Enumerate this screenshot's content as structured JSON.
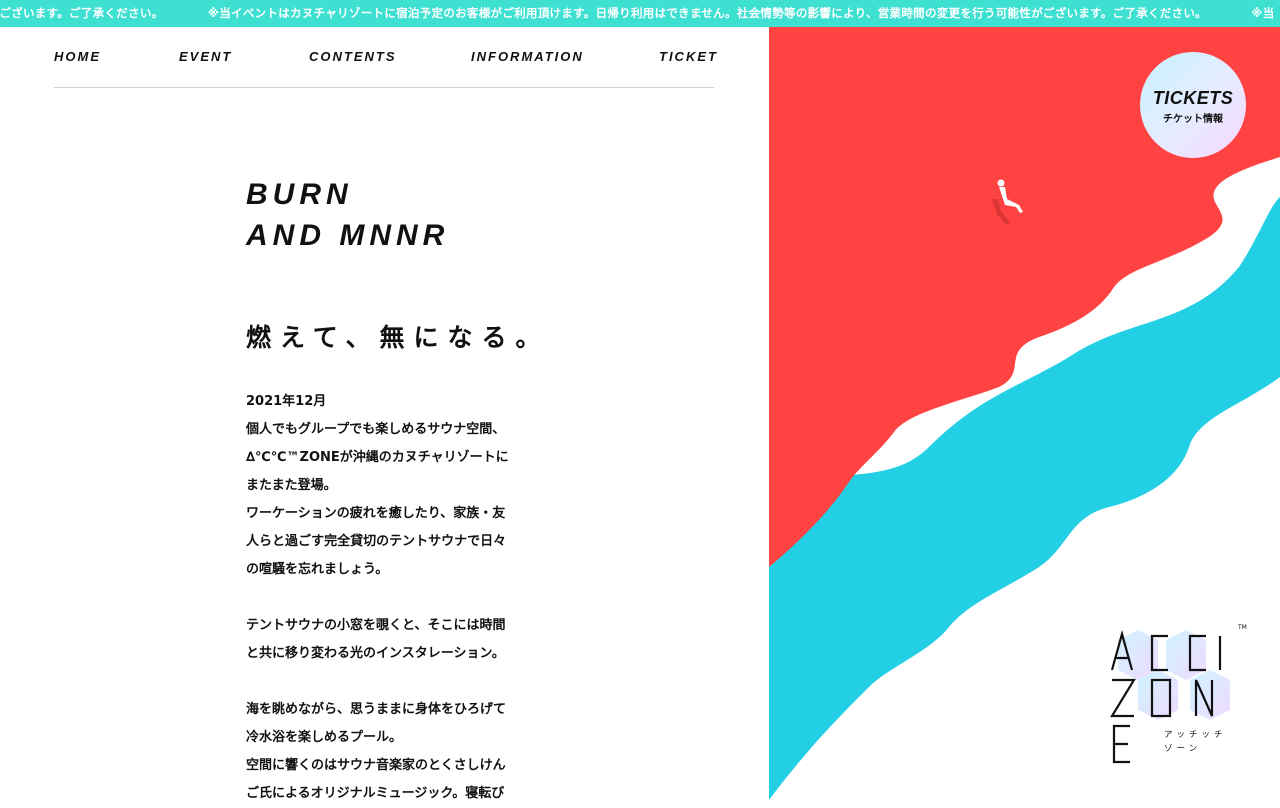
{
  "ticker": {
    "items": [
      "能性がございます。ご了承ください。",
      "※当イベントはカヌチャリゾートに宿泊予定のお客様がご利用頂けます。日帰り利用はできません。社会情勢等の影響により、営業時間の変更を行う可能性がございます。ご了承ください。",
      "※当"
    ]
  },
  "nav": {
    "home": "HOME",
    "event": "EVENT",
    "contents": "CONTENTS",
    "information": "INFORMATION",
    "ticket": "TICKET"
  },
  "hero": {
    "line1": "BURN",
    "line2": "AND MNNR",
    "jp_title": "燃えて、無になる。"
  },
  "body": {
    "lines": [
      "2021年12月",
      "個人でもグループでも楽しめるサウナ空間、",
      "∆℃℃™ZONEが沖縄のカヌチャリゾートに",
      "またまた登場。",
      "ワーケーションの疲れを癒したり、家族・友",
      "人らと過ごす完全貸切のテントサウナで日々",
      "の喧騒を忘れましょう。",
      "",
      "テントサウナの小窓を覗くと、そこには時間",
      "と共に移り変わる光のインスタレーション。",
      "",
      "海を眺めながら、思うままに身体をひろげて",
      "冷水浴を楽しめるプール。",
      "空間に響くのはサウナ音楽家のとくさしけん",
      "ご氏によるオリジナルミュージック。寝転び"
    ]
  },
  "tickets_button": {
    "title": "TICKETS",
    "subtitle": "チケット情報"
  },
  "logo": {
    "kana_line1": "アッチッチ",
    "kana_line2": "ゾーン",
    "tm": "TM"
  },
  "colors": {
    "ticker_bg": "#3ee0d2",
    "art_red": "#ff4242",
    "art_cyan": "#22cfe5",
    "art_white": "#ffffff",
    "text": "#111111"
  },
  "icons": {
    "figure": "sitting-person-icon",
    "logo": "accizone-logo"
  }
}
